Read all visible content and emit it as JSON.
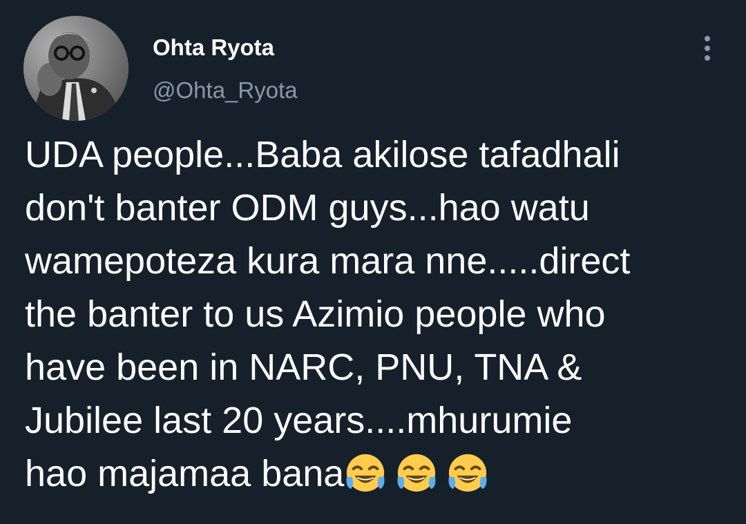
{
  "tweet": {
    "author": {
      "display_name": "Ohta Ryota",
      "handle": "@Ohta_Ryota",
      "avatar": "profile-photo"
    },
    "menu_icon": "more-vertical-icon",
    "text_lines": [
      "UDA people...Baba akilose tafadhali",
      "don't banter ODM guys...hao watu",
      "wamepoteza kura mara nne.....direct",
      "the banter to us Azimio people who",
      "have been in NARC, PNU, TNA &",
      "Jubilee last 20 years....mhurumie",
      "hao majamaa bana"
    ],
    "emojis": [
      "face-with-tears-of-joy",
      "face-with-tears-of-joy",
      "face-with-tears-of-joy"
    ],
    "colors": {
      "background": "#15202b",
      "text": "#ffffff",
      "secondary_text": "#8b98a5"
    }
  }
}
